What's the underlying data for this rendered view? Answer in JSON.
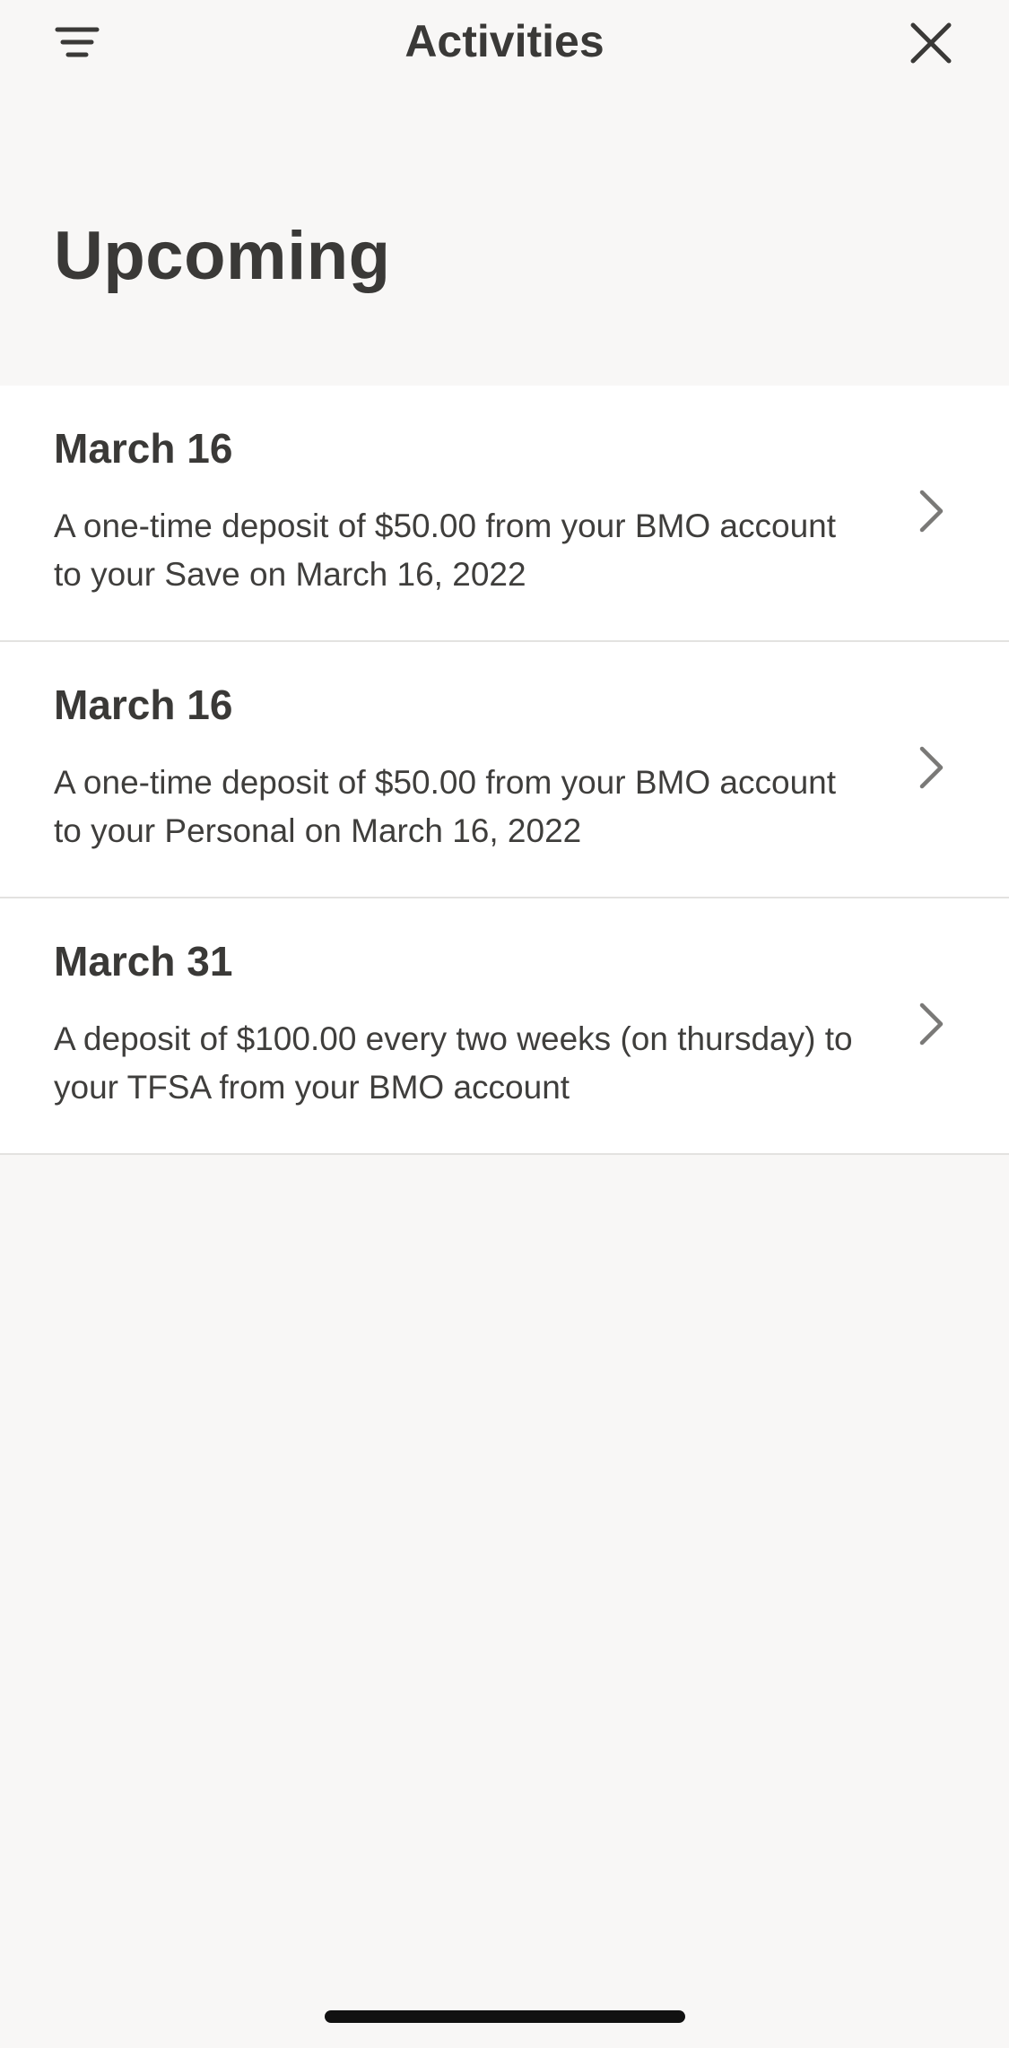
{
  "header": {
    "title": "Activities",
    "filter_icon": "filter-lines-icon",
    "close_icon": "close-x-icon"
  },
  "section": {
    "title": "Upcoming"
  },
  "activities": [
    {
      "date": "March 16",
      "description": "A one-time deposit of $50.00 from your BMO account to your Save on March 16, 2022"
    },
    {
      "date": "March 16",
      "description": "A one-time deposit of $50.00 from your BMO account to your Personal on March 16, 2022"
    },
    {
      "date": "March 31",
      "description": "A deposit of $100.00 every two weeks (on thursday) to your TFSA from your BMO account"
    }
  ],
  "colors": {
    "background": "#f8f7f6",
    "card": "#ffffff",
    "text": "#3a3937",
    "chevron": "#7a7977",
    "divider": "#e3e2e0"
  }
}
